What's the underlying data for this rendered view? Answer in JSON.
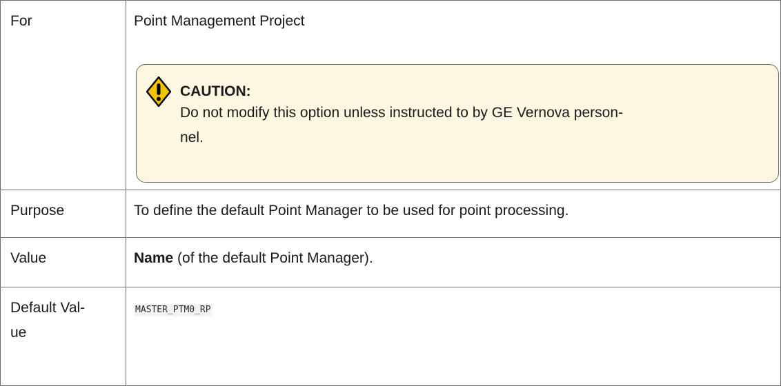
{
  "rows": {
    "for": {
      "label": "For",
      "value": "Point Management Project"
    },
    "purpose": {
      "label": "Purpose",
      "value": "To define the default Point Manager to be used for point processing."
    },
    "value": {
      "label": "Value",
      "bold_name": "Name",
      "rest": " (of the default Point Manager)."
    },
    "default_value": {
      "label_line1": "Default Val-",
      "label_line2": "ue",
      "value": "MASTER_PTM0_RP"
    }
  },
  "caution": {
    "icon": "warning-diamond-icon",
    "heading": "CAUTION:",
    "text_line1": "Do not modify this option unless instructed to by GE Vernova person-",
    "text_line2": "nel.",
    "colors": {
      "background": "#fcf7e1",
      "icon_fill": "#f5c400",
      "icon_mark": "#000000"
    }
  }
}
